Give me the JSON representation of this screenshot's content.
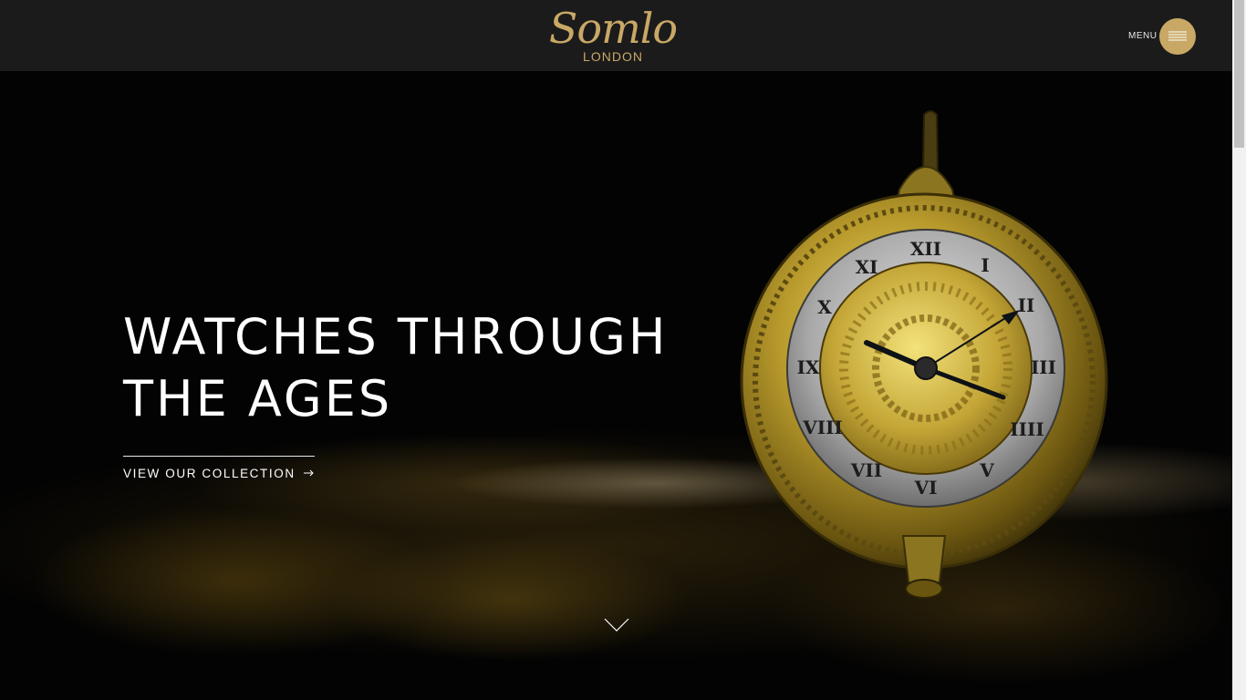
{
  "header": {
    "logo_script": "Somlo",
    "logo_sub": "LONDON",
    "menu_label": "MENU",
    "menu_icon": "hamburger-icon"
  },
  "hero": {
    "title_line1": "WATCHES THROUGH",
    "title_line2": "THE AGES",
    "cta_label": "VIEW OUR COLLECTION",
    "cta_icon": "arrow-right-icon",
    "scroll_icon": "chevron-down-icon",
    "image": "antique-pocket-watch",
    "watch_numerals": [
      "XII",
      "I",
      "II",
      "III",
      "IIII",
      "V",
      "VI",
      "VII",
      "VIII",
      "IX",
      "X",
      "XI"
    ]
  },
  "colors": {
    "accent_gold": "#c9a866",
    "header_bg": "#1b1b1b",
    "hero_bg": "#030303",
    "text": "#ffffff"
  }
}
